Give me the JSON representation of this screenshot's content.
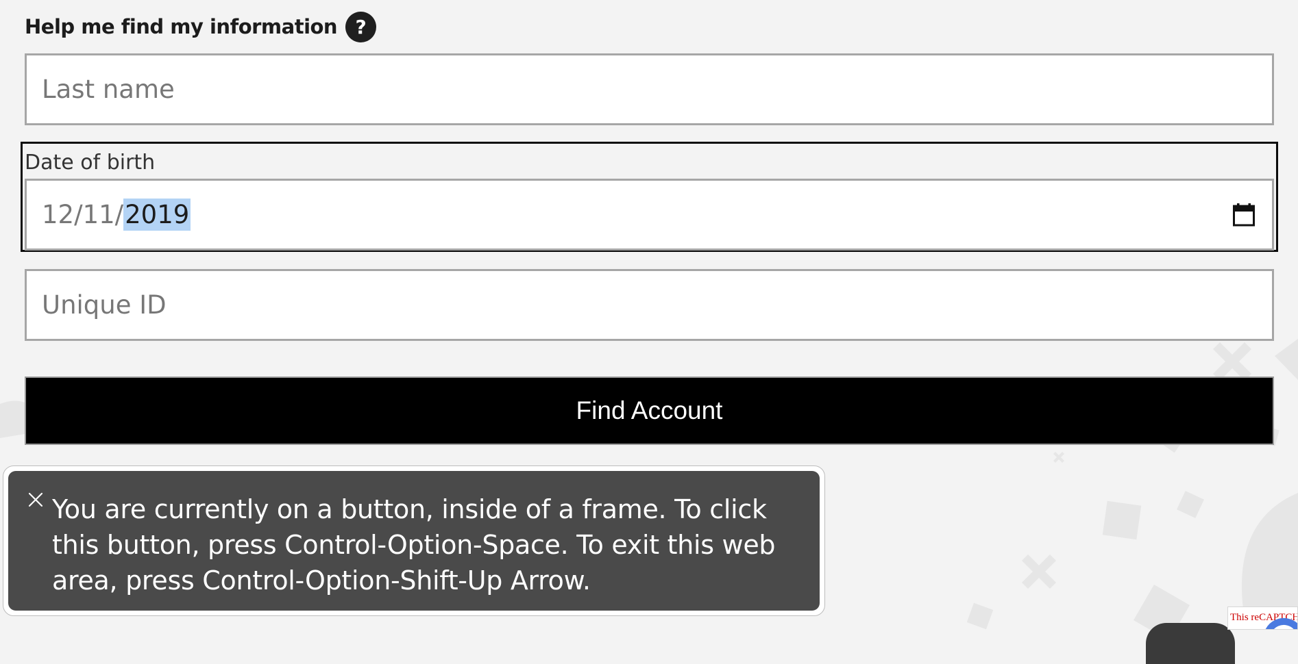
{
  "help": {
    "title": "Help me find my information",
    "icon_glyph": "?",
    "icon": "help-circle-icon"
  },
  "last_name": {
    "placeholder": "Last name",
    "value": ""
  },
  "dob": {
    "label": "Date of birth",
    "month": "12",
    "separator_1": "/",
    "day": "11",
    "separator_2": "/",
    "year": "2019",
    "selected_segment": "year",
    "icon": "calendar-icon"
  },
  "unique_id": {
    "placeholder": "Unique ID",
    "value": ""
  },
  "find_button": {
    "label": "Find Account"
  },
  "tooltip": {
    "close_icon": "close-icon",
    "text": "You are currently on a button, inside of a frame. To click this button, press Control-Option-Space. To exit this web area, press Control-Option-Shift-Up Arrow."
  },
  "recaptcha": {
    "text": "This reCAPTCHA"
  },
  "colors": {
    "page_background": "#f3f3f3",
    "button_background": "#000000",
    "button_text": "#ffffff",
    "tooltip_background": "#4a4a4a",
    "selection_highlight": "#b3d3f5",
    "field_border": "#a6a6a6",
    "focus_border": "#0b0b0b"
  }
}
